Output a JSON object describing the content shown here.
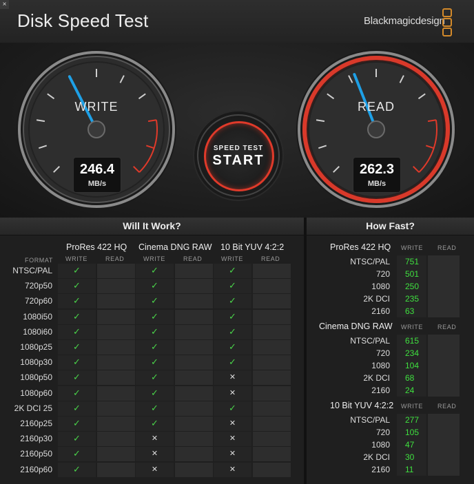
{
  "window": {
    "close_glyph": "×",
    "title": "Disk Speed Test",
    "brand": "Blackmagicdesign"
  },
  "gauges": {
    "write": {
      "label": "WRITE",
      "value": "246.4",
      "unit": "MB/s",
      "needle_fraction": 0.4
    },
    "read": {
      "label": "READ",
      "value": "262.3",
      "unit": "MB/s",
      "needle_fraction": 0.42
    }
  },
  "start_button": {
    "top_label": "SPEED TEST",
    "main_label": "START"
  },
  "settings_icon": "gear-icon",
  "will_it_work": {
    "title": "Will It Work?",
    "format_header": "FORMAT",
    "write_header": "WRITE",
    "read_header": "READ",
    "codecs": [
      "ProRes 422 HQ",
      "Cinema DNG RAW",
      "10 Bit YUV 4:2:2"
    ],
    "rows": [
      {
        "format": "NTSC/PAL",
        "results": [
          "ok",
          "ok",
          "ok"
        ]
      },
      {
        "format": "720p50",
        "results": [
          "ok",
          "ok",
          "ok"
        ]
      },
      {
        "format": "720p60",
        "results": [
          "ok",
          "ok",
          "ok"
        ]
      },
      {
        "format": "1080i50",
        "results": [
          "ok",
          "ok",
          "ok"
        ]
      },
      {
        "format": "1080i60",
        "results": [
          "ok",
          "ok",
          "ok"
        ]
      },
      {
        "format": "1080p25",
        "results": [
          "ok",
          "ok",
          "ok"
        ]
      },
      {
        "format": "1080p30",
        "results": [
          "ok",
          "ok",
          "ok"
        ]
      },
      {
        "format": "1080p50",
        "results": [
          "ok",
          "ok",
          "no"
        ]
      },
      {
        "format": "1080p60",
        "results": [
          "ok",
          "ok",
          "no"
        ]
      },
      {
        "format": "2K DCI 25",
        "results": [
          "ok",
          "ok",
          "ok"
        ]
      },
      {
        "format": "2160p25",
        "results": [
          "ok",
          "ok",
          "no"
        ]
      },
      {
        "format": "2160p30",
        "results": [
          "ok",
          "no",
          "no"
        ]
      },
      {
        "format": "2160p50",
        "results": [
          "ok",
          "no",
          "no"
        ]
      },
      {
        "format": "2160p60",
        "results": [
          "ok",
          "no",
          "no"
        ]
      }
    ],
    "ok_glyph": "✓",
    "no_glyph": "✕"
  },
  "how_fast": {
    "title": "How Fast?",
    "write_header": "WRITE",
    "read_header": "READ",
    "groups": [
      {
        "name": "ProRes 422 HQ",
        "rows": [
          {
            "label": "NTSC/PAL",
            "write": "751"
          },
          {
            "label": "720",
            "write": "501"
          },
          {
            "label": "1080",
            "write": "250"
          },
          {
            "label": "2K DCI",
            "write": "235"
          },
          {
            "label": "2160",
            "write": "63"
          }
        ]
      },
      {
        "name": "Cinema DNG RAW",
        "rows": [
          {
            "label": "NTSC/PAL",
            "write": "615"
          },
          {
            "label": "720",
            "write": "234"
          },
          {
            "label": "1080",
            "write": "104"
          },
          {
            "label": "2K DCI",
            "write": "68"
          },
          {
            "label": "2160",
            "write": "24"
          }
        ]
      },
      {
        "name": "10 Bit YUV 4:2:2",
        "rows": [
          {
            "label": "NTSC/PAL",
            "write": "277"
          },
          {
            "label": "720",
            "write": "105"
          },
          {
            "label": "1080",
            "write": "47"
          },
          {
            "label": "2K DCI",
            "write": "30"
          },
          {
            "label": "2160",
            "write": "11"
          }
        ]
      }
    ]
  },
  "colors": {
    "ok": "#4ad34a",
    "speed": "#3fe03f",
    "needle": "#1ea0e6",
    "read_ring": "#e03a2a",
    "logo": "#d48a2a"
  }
}
